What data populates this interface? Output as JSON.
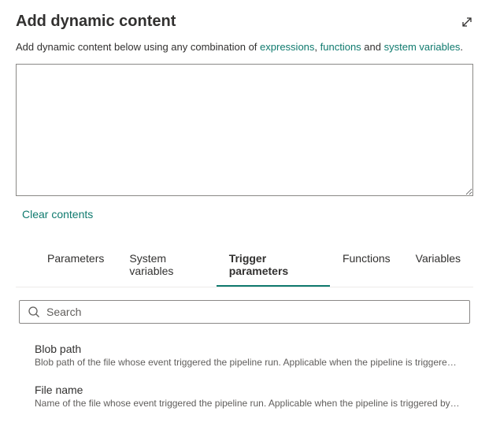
{
  "header": {
    "title": "Add dynamic content"
  },
  "description": {
    "prefix": "Add dynamic content below using any combination of ",
    "link1": "expressions",
    "sep1": ", ",
    "link2": "functions",
    "sep2": " and ",
    "link3": "system variables",
    "suffix": "."
  },
  "editor": {
    "value": ""
  },
  "actions": {
    "clear": "Clear contents"
  },
  "tabs": [
    {
      "label": "Parameters",
      "active": false
    },
    {
      "label": "System variables",
      "active": false
    },
    {
      "label": "Trigger parameters",
      "active": true
    },
    {
      "label": "Functions",
      "active": false
    },
    {
      "label": "Variables",
      "active": false
    }
  ],
  "search": {
    "placeholder": "Search",
    "value": ""
  },
  "items": [
    {
      "title": "Blob path",
      "description": "Blob path of the file whose event triggered the pipeline run. Applicable when the pipeline is triggered ..."
    },
    {
      "title": "File name",
      "description": "Name of the file whose event triggered the pipeline run. Applicable when the pipeline is triggered by s..."
    }
  ]
}
